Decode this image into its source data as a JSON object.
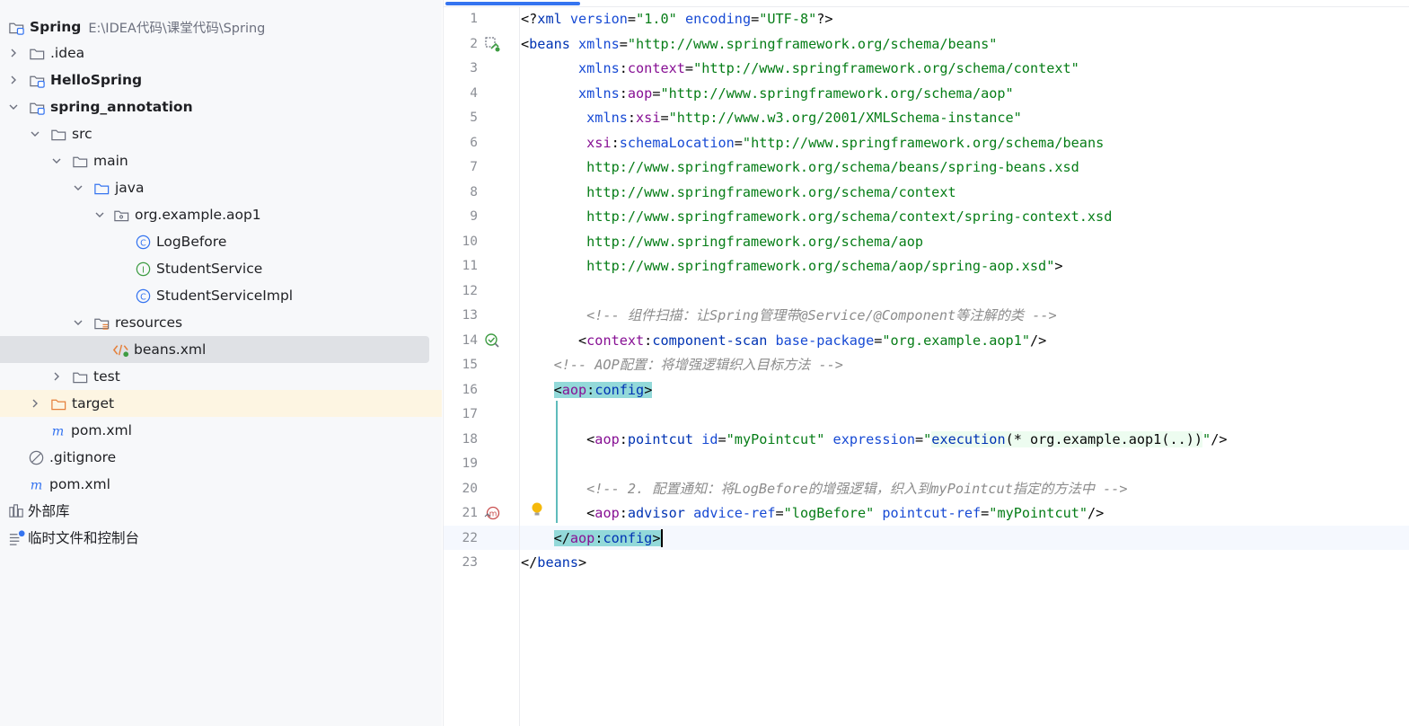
{
  "project": {
    "root_name": "Spring",
    "root_path": "E:\\IDEA代码\\课堂代码\\Spring",
    "items": [
      {
        "label": ".idea"
      },
      {
        "label": "HelloSpring"
      },
      {
        "label": "spring_annotation"
      },
      {
        "label": "src"
      },
      {
        "label": "main"
      },
      {
        "label": "java"
      },
      {
        "label": "org.example.aop1"
      },
      {
        "label": "LogBefore"
      },
      {
        "label": "StudentService"
      },
      {
        "label": "StudentServiceImpl"
      },
      {
        "label": "resources"
      },
      {
        "label": "beans.xml"
      },
      {
        "label": "test"
      },
      {
        "label": "target"
      },
      {
        "label": "pom.xml"
      },
      {
        "label": ".gitignore"
      },
      {
        "label": "pom.xml"
      },
      {
        "label": "外部库"
      },
      {
        "label": "临时文件和控制台"
      }
    ]
  },
  "editor": {
    "line_numbers": [
      "1",
      "2",
      "3",
      "4",
      "5",
      "6",
      "7",
      "8",
      "9",
      "10",
      "11",
      "12",
      "13",
      "14",
      "15",
      "16",
      "17",
      "18",
      "19",
      "20",
      "21",
      "22",
      "23"
    ],
    "lines": [
      [
        {
          "c": "t-p",
          "t": "<?"
        },
        {
          "c": "t-tag",
          "t": "xml"
        },
        {
          "c": "t-p",
          "t": " "
        },
        {
          "c": "t-attr",
          "t": "version"
        },
        {
          "c": "t-p",
          "t": "="
        },
        {
          "c": "t-val",
          "t": "\"1.0\""
        },
        {
          "c": "t-p",
          "t": " "
        },
        {
          "c": "t-attr",
          "t": "encoding"
        },
        {
          "c": "t-p",
          "t": "="
        },
        {
          "c": "t-val",
          "t": "\"UTF-8\""
        },
        {
          "c": "t-p",
          "t": "?>"
        }
      ],
      [
        {
          "c": "t-p",
          "t": "<"
        },
        {
          "c": "t-tag",
          "t": "beans"
        },
        {
          "c": "t-p",
          "t": " "
        },
        {
          "c": "t-attr",
          "t": "xmlns"
        },
        {
          "c": "t-p",
          "t": "="
        },
        {
          "c": "t-val",
          "t": "\"http://www.springframework.org/schema/beans\""
        }
      ],
      [
        {
          "c": "t-p",
          "t": "       "
        },
        {
          "c": "t-attr",
          "t": "xmlns"
        },
        {
          "c": "t-p",
          "t": ":"
        },
        {
          "c": "t-ns",
          "t": "context"
        },
        {
          "c": "t-p",
          "t": "="
        },
        {
          "c": "t-val",
          "t": "\"http://www.springframework.org/schema/context\""
        }
      ],
      [
        {
          "c": "t-p",
          "t": "       "
        },
        {
          "c": "t-attr",
          "t": "xmlns"
        },
        {
          "c": "t-p",
          "t": ":"
        },
        {
          "c": "t-ns",
          "t": "aop"
        },
        {
          "c": "t-p",
          "t": "="
        },
        {
          "c": "t-val",
          "t": "\"http://www.springframework.org/schema/aop\""
        }
      ],
      [
        {
          "c": "t-p",
          "t": "        "
        },
        {
          "c": "t-attr",
          "t": "xmlns"
        },
        {
          "c": "t-p",
          "t": ":"
        },
        {
          "c": "t-ns",
          "t": "xsi"
        },
        {
          "c": "t-p",
          "t": "="
        },
        {
          "c": "t-val",
          "t": "\"http://www.w3.org/2001/XMLSchema-instance\""
        }
      ],
      [
        {
          "c": "t-p",
          "t": "        "
        },
        {
          "c": "t-ns",
          "t": "xsi"
        },
        {
          "c": "t-p",
          "t": ":"
        },
        {
          "c": "t-attr",
          "t": "schemaLocation"
        },
        {
          "c": "t-p",
          "t": "="
        },
        {
          "c": "t-val",
          "t": "\"http://www.springframework.org/schema/beans"
        }
      ],
      [
        {
          "c": "t-val",
          "t": "        http://www.springframework.org/schema/beans/spring-beans.xsd"
        }
      ],
      [
        {
          "c": "t-val",
          "t": "        http://www.springframework.org/schema/context"
        }
      ],
      [
        {
          "c": "t-val",
          "t": "        http://www.springframework.org/schema/context/spring-context.xsd"
        }
      ],
      [
        {
          "c": "t-val",
          "t": "        http://www.springframework.org/schema/aop"
        }
      ],
      [
        {
          "c": "t-val",
          "t": "        http://www.springframework.org/schema/aop/spring-aop.xsd\""
        },
        {
          "c": "t-p",
          "t": ">"
        }
      ],
      [
        {
          "c": "t-p",
          "t": ""
        }
      ],
      [
        {
          "c": "t-cm",
          "t": "        <!-- 组件扫描：让Spring管理带@Service/@Component等注解的类 -->"
        }
      ],
      [
        {
          "c": "t-p",
          "t": "       <"
        },
        {
          "c": "t-ns",
          "t": "context"
        },
        {
          "c": "t-p",
          "t": ":"
        },
        {
          "c": "t-tag",
          "t": "component-scan"
        },
        {
          "c": "t-p",
          "t": " "
        },
        {
          "c": "t-attr",
          "t": "base-package"
        },
        {
          "c": "t-p",
          "t": "="
        },
        {
          "c": "t-val",
          "t": "\"org.example.aop1\""
        },
        {
          "c": "t-p",
          "t": "/>"
        }
      ],
      [
        {
          "c": "t-cm",
          "t": "    <!-- AOP配置：将增强逻辑织入目标方法 -->"
        }
      ],
      [
        {
          "c": "t-p",
          "t": "    "
        },
        {
          "c": "t-p hl-tag",
          "t": "<"
        },
        {
          "c": "t-ns hl-tag",
          "t": "aop"
        },
        {
          "c": "t-p hl-tag",
          "t": ":"
        },
        {
          "c": "t-tag hl-tag",
          "t": "config"
        },
        {
          "c": "t-p hl-tag",
          "t": ">"
        }
      ],
      [
        {
          "c": "t-p",
          "t": ""
        }
      ],
      [
        {
          "c": "t-p",
          "t": "        <"
        },
        {
          "c": "t-ns",
          "t": "aop"
        },
        {
          "c": "t-p",
          "t": ":"
        },
        {
          "c": "t-tag",
          "t": "pointcut"
        },
        {
          "c": "t-p",
          "t": " "
        },
        {
          "c": "t-attr",
          "t": "id"
        },
        {
          "c": "t-p",
          "t": "="
        },
        {
          "c": "t-val",
          "t": "\"myPointcut\""
        },
        {
          "c": "t-p",
          "t": " "
        },
        {
          "c": "t-attr",
          "t": "expression"
        },
        {
          "c": "t-p",
          "t": "="
        },
        {
          "c": "t-val",
          "t": "\""
        },
        {
          "c": "t-tag hl-inj",
          "t": "execution"
        },
        {
          "c": "t-p hl-inj",
          "t": "(* org.example.aop1(..))"
        },
        {
          "c": "t-val",
          "t": "\""
        },
        {
          "c": "t-p",
          "t": "/>"
        }
      ],
      [
        {
          "c": "t-p",
          "t": ""
        }
      ],
      [
        {
          "c": "t-cm",
          "t": "        <!-- 2. 配置通知：将LogBefore的增强逻辑，织入到myPointcut指定的方法中 -->"
        }
      ],
      [
        {
          "c": "t-p",
          "t": "        <"
        },
        {
          "c": "t-ns",
          "t": "aop"
        },
        {
          "c": "t-p",
          "t": ":"
        },
        {
          "c": "t-tag",
          "t": "advisor"
        },
        {
          "c": "t-p",
          "t": " "
        },
        {
          "c": "t-attr",
          "t": "advice-ref"
        },
        {
          "c": "t-p",
          "t": "="
        },
        {
          "c": "t-val",
          "t": "\"logBefore\""
        },
        {
          "c": "t-p",
          "t": " "
        },
        {
          "c": "t-attr",
          "t": "pointcut-ref"
        },
        {
          "c": "t-p",
          "t": "="
        },
        {
          "c": "t-val",
          "t": "\"myPointcut\""
        },
        {
          "c": "t-p",
          "t": "/>"
        }
      ],
      [
        {
          "c": "t-p",
          "t": "    "
        },
        {
          "c": "t-p hl-tag",
          "t": "</"
        },
        {
          "c": "t-ns hl-tag",
          "t": "aop"
        },
        {
          "c": "t-p hl-tag",
          "t": ":"
        },
        {
          "c": "t-tag hl-tag",
          "t": "config"
        },
        {
          "c": "t-p hl-tag",
          "t": ">"
        }
      ],
      [
        {
          "c": "t-p",
          "t": "</"
        },
        {
          "c": "t-tag",
          "t": "beans"
        },
        {
          "c": "t-p",
          "t": ">"
        }
      ]
    ]
  }
}
